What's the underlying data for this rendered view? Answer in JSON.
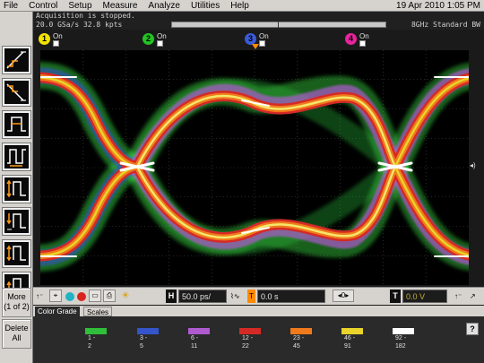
{
  "menu": {
    "items": [
      "File",
      "Control",
      "Setup",
      "Measure",
      "Analyze",
      "Utilities",
      "Help"
    ],
    "datetime": "19 Apr 2010  1:05 PM"
  },
  "status": {
    "message": "Acquisition is stopped.",
    "sample_rate": "20.0 GSa/s   32.8 kpts",
    "bandwidth": "8GHz Standard BW"
  },
  "channels": [
    {
      "number": "1",
      "label": "On",
      "color": "#f2e300"
    },
    {
      "number": "2",
      "label": "On",
      "color": "#22c322"
    },
    {
      "number": "3",
      "label": "On",
      "color": "#3a5ad8"
    },
    {
      "number": "4",
      "label": "On",
      "color": "#e6249c"
    }
  ],
  "side_buttons": {
    "more": "More\n(1 of 2)",
    "delete": "Delete\nAll"
  },
  "controls": {
    "horizontal_key": "H",
    "timebase": "50.0 ps/",
    "delay": "0.0 s",
    "delay_step": "0",
    "trigger_key": "T",
    "trigger_level": "0.0 V"
  },
  "tabs": {
    "color_grade": "Color Grade",
    "scales": "Scales"
  },
  "color_grade_legend": [
    {
      "low": "1 -",
      "high": "2",
      "color": "#2fbf3a"
    },
    {
      "low": "3 -",
      "high": "5",
      "color": "#3455c9"
    },
    {
      "low": "6 -",
      "high": "11",
      "color": "#b05ad0"
    },
    {
      "low": "12 -",
      "high": "22",
      "color": "#d42a26"
    },
    {
      "low": "23 -",
      "high": "45",
      "color": "#f07a1c"
    },
    {
      "low": "46 -",
      "high": "91",
      "color": "#e8d42a"
    },
    {
      "low": "92 -",
      "high": "182",
      "color": "#ffffff"
    }
  ],
  "help_label": "?"
}
